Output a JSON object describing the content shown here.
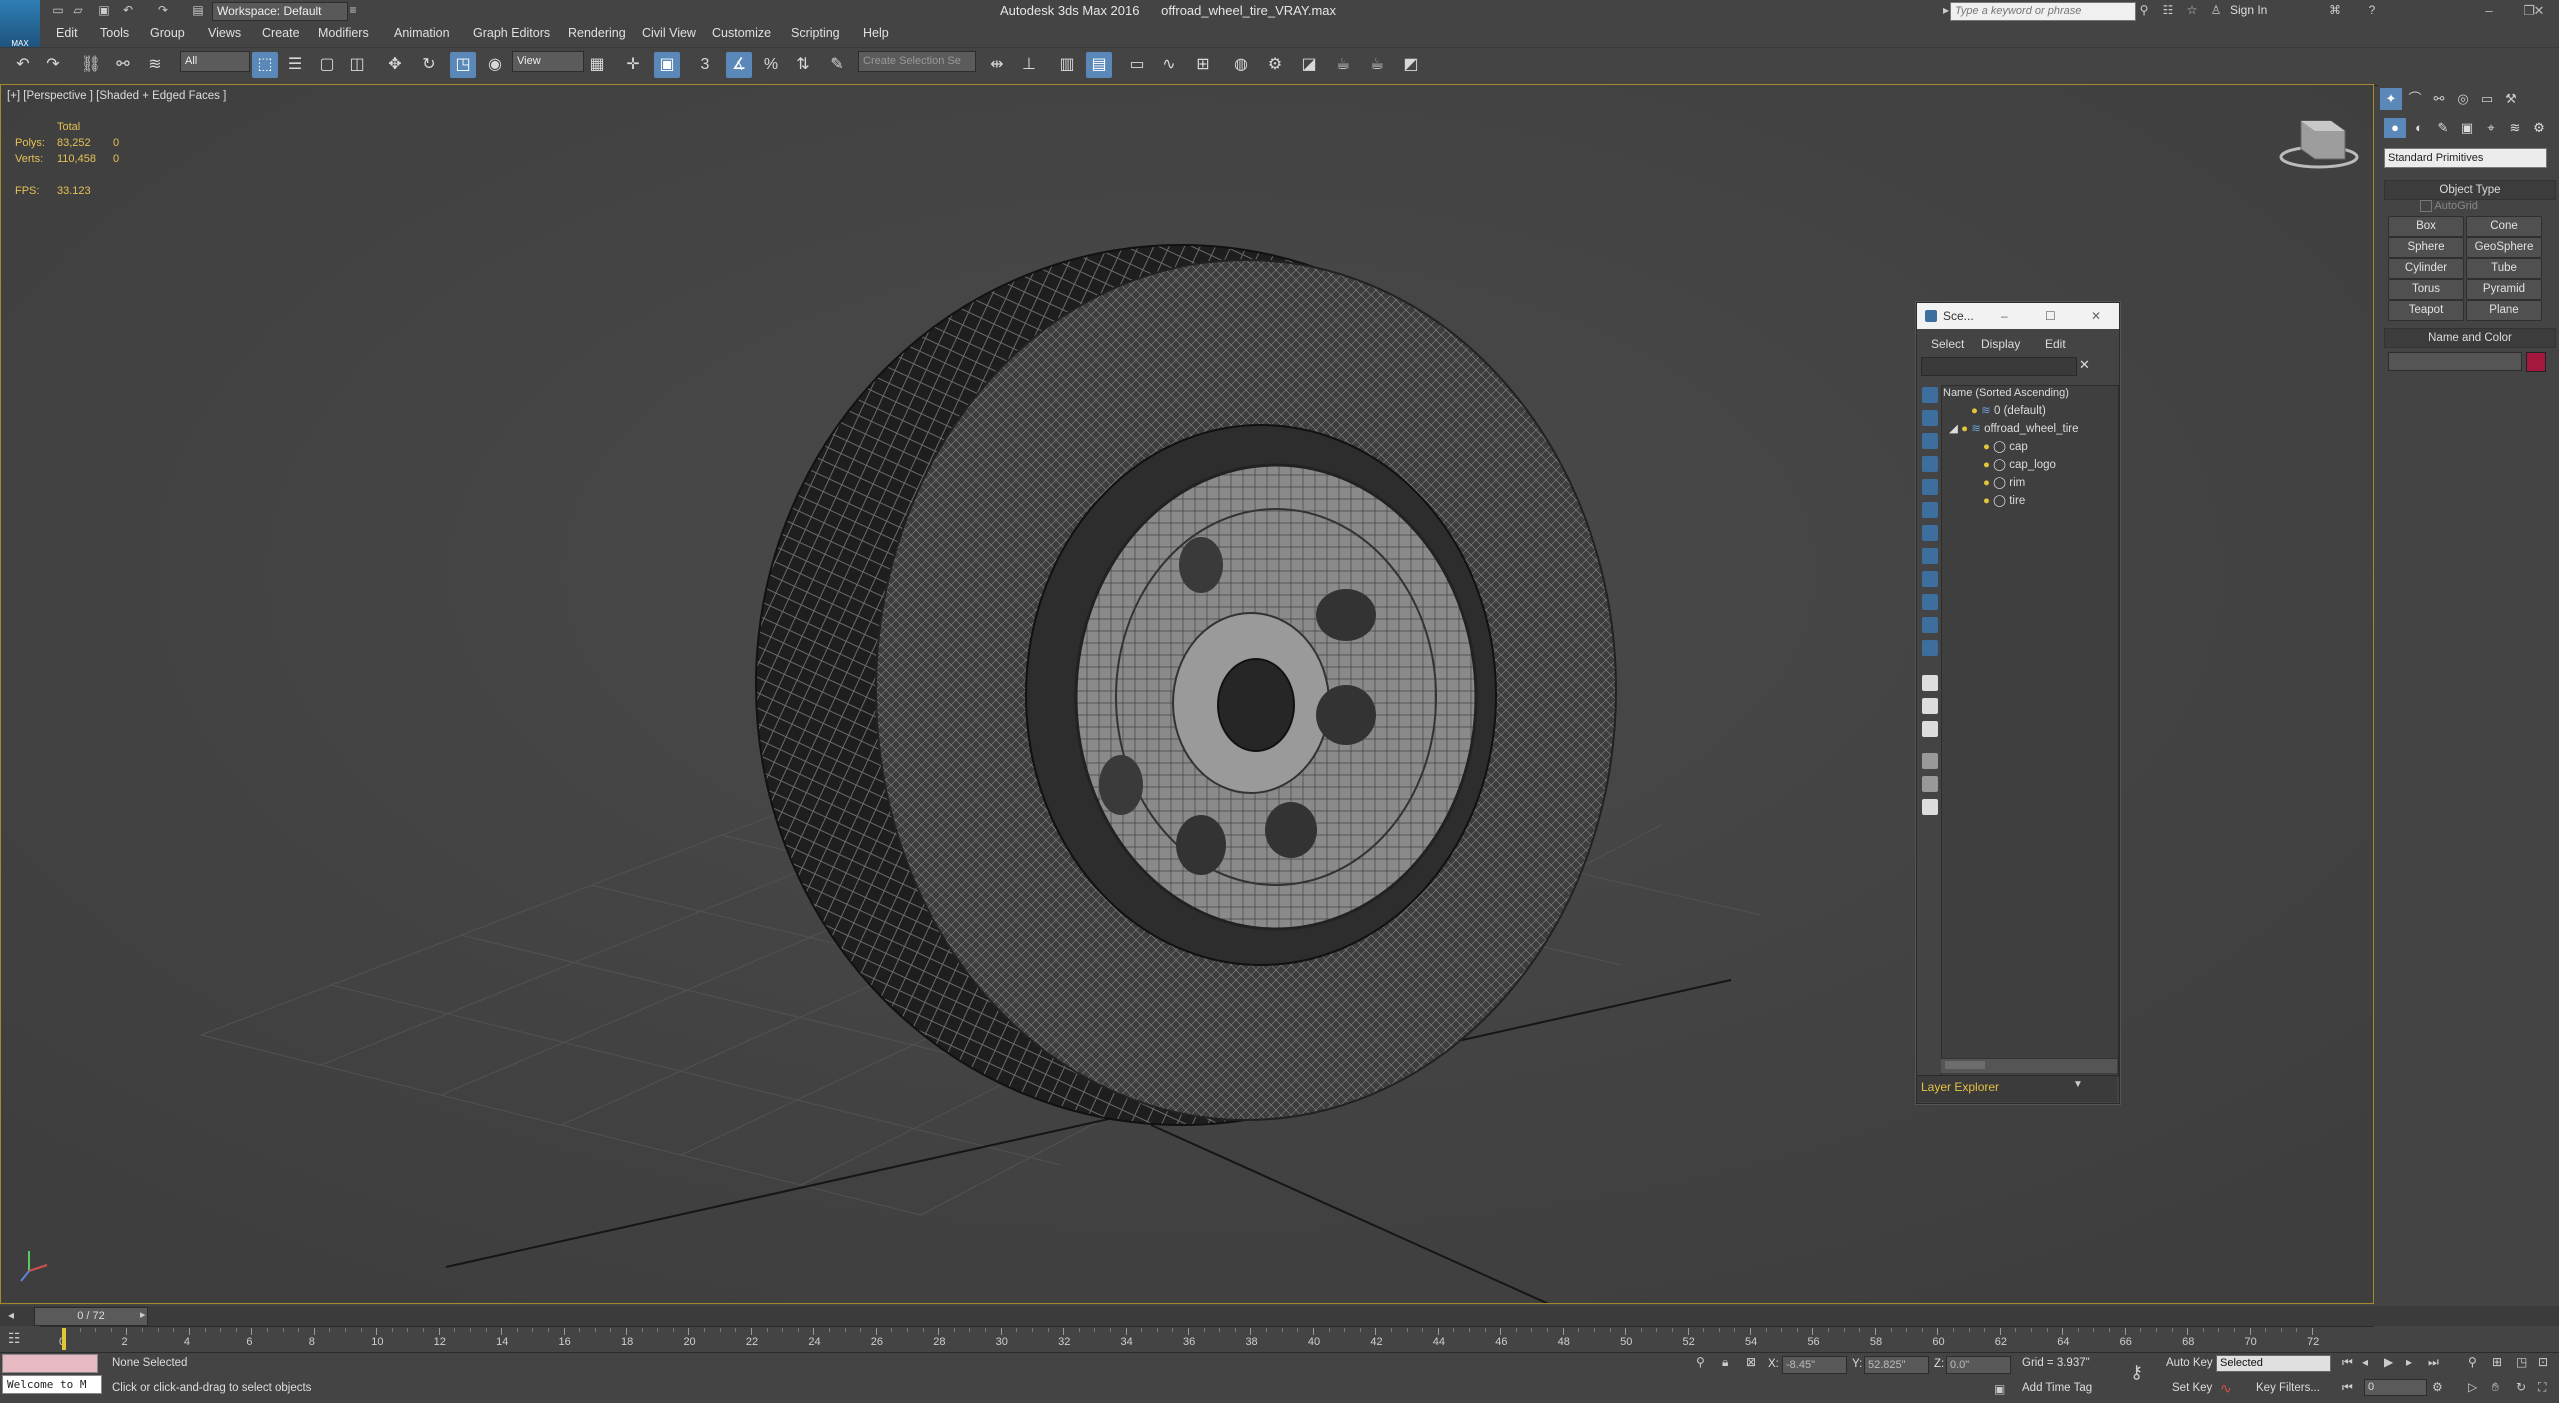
{
  "app": {
    "title": "Autodesk 3ds Max 2016",
    "filename": "offroad_wheel_tire_VRAY.max",
    "logo_text": "MAX",
    "workspace": "Workspace: Default",
    "search_placeholder": "Type a keyword or phrase",
    "sign_in": "Sign In"
  },
  "menu": [
    "Edit",
    "Tools",
    "Group",
    "Views",
    "Create",
    "Modifiers",
    "Animation",
    "Graph Editors",
    "Rendering",
    "Civil View",
    "Customize",
    "Scripting",
    "Help"
  ],
  "toolbar": {
    "selection_filter": "All",
    "ref_coord": "View",
    "named_selection": "Create Selection Se"
  },
  "viewport": {
    "label": "[+] [Perspective ] [Shaded + Edged Faces ]",
    "stats": {
      "total_label": "Total",
      "polys_label": "Polys:",
      "polys_value": "83,252",
      "polys_sel": "0",
      "verts_label": "Verts:",
      "verts_value": "110,458",
      "verts_sel": "0",
      "fps_label": "FPS:",
      "fps_value": "33.123"
    }
  },
  "command_panel": {
    "category": "Standard Primitives",
    "object_type_title": "Object Type",
    "autogrid": "AutoGrid",
    "buttons": [
      "Box",
      "Cone",
      "Sphere",
      "GeoSphere",
      "Cylinder",
      "Tube",
      "Torus",
      "Pyramid",
      "Teapot",
      "Plane"
    ],
    "name_color_title": "Name and Color",
    "object_color": "#a3183c"
  },
  "scene_explorer": {
    "title": "Sce...",
    "menus": [
      "Select",
      "Display",
      "Edit"
    ],
    "column_header": "Name (Sorted Ascending)",
    "rows": [
      {
        "name": "0 (default)"
      },
      {
        "name": "offroad_wheel_tire"
      },
      {
        "name": "cap"
      },
      {
        "name": "cap_logo"
      },
      {
        "name": "rim"
      },
      {
        "name": "tire"
      }
    ],
    "footer": "Layer Explorer"
  },
  "timeline": {
    "frame_counter": "0 / 72",
    "ticks": [
      "0",
      "2",
      "4",
      "6",
      "8",
      "10",
      "12",
      "14",
      "16",
      "18",
      "20",
      "22",
      "24",
      "26",
      "28",
      "30",
      "32",
      "34",
      "36",
      "38",
      "40",
      "42",
      "44",
      "46",
      "48",
      "50",
      "52",
      "54",
      "56",
      "58",
      "60",
      "62",
      "64",
      "66",
      "68",
      "70",
      "72"
    ]
  },
  "status": {
    "maxscript": "Welcome to M",
    "selection": "None Selected",
    "prompt": "Click or click-and-drag to select objects",
    "x_label": "X:",
    "x_value": "-8.45\"",
    "y_label": "Y:",
    "y_value": "52.825\"",
    "z_label": "Z:",
    "z_value": "0.0\"",
    "grid": "Grid = 3.937\"",
    "add_time_tag": "Add Time Tag",
    "auto_key": "Auto Key",
    "set_key": "Set Key",
    "key_mode": "Selected",
    "key_filters": "Key Filters...",
    "frame": "0"
  }
}
